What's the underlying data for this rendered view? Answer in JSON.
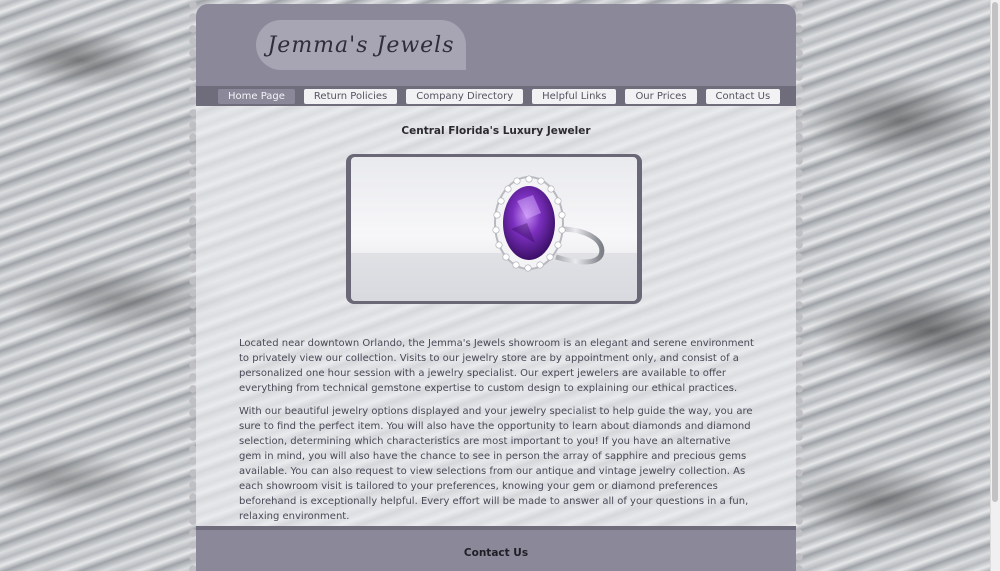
{
  "brand": {
    "logo_text": "Jemma's Jewels"
  },
  "nav": {
    "items": [
      {
        "label": "Home Page",
        "active": true
      },
      {
        "label": "Return Policies",
        "active": false
      },
      {
        "label": "Company Directory",
        "active": false
      },
      {
        "label": "Helpful Links",
        "active": false
      },
      {
        "label": "Our Prices",
        "active": false
      },
      {
        "label": "Contact Us",
        "active": false
      }
    ]
  },
  "main": {
    "tagline": "Central Florida's Luxury Jeweler",
    "image": {
      "subject": "amethyst-halo-ring"
    },
    "paragraphs": [
      "Located near downtown Orlando, the Jemma's Jewels showroom is an elegant and serene environment to privately view our collection. Visits to our jewelry store are by appointment only, and consist of a personalized one hour session with a jewelry specialist. Our expert jewelers are available to offer everything from technical gemstone expertise to custom design to explaining our ethical practices.",
      "With our beautiful jewelry options displayed and your jewelry specialist to help guide the way, you are sure to find the perfect item. You will also have the opportunity to learn about diamonds and diamond selection, determining which characteristics are most important to you! If you have an alternative gem in mind, you will also have the chance to see in person the array of sapphire and precious gems available. You can also request to view selections from our antique and vintage jewelry collection. As each showroom visit is tailored to your preferences, knowing your gem or diamond preferences beforehand is exceptionally helpful. Every effort will be made to answer all of your questions in a fun, relaxing environment."
    ]
  },
  "footer": {
    "title": "Contact Us"
  },
  "colors": {
    "header": "#8b8899",
    "nav_bar": "#6f6c7c",
    "logo_tab": "#a7a4b3",
    "gem": "#7b2fbf"
  }
}
